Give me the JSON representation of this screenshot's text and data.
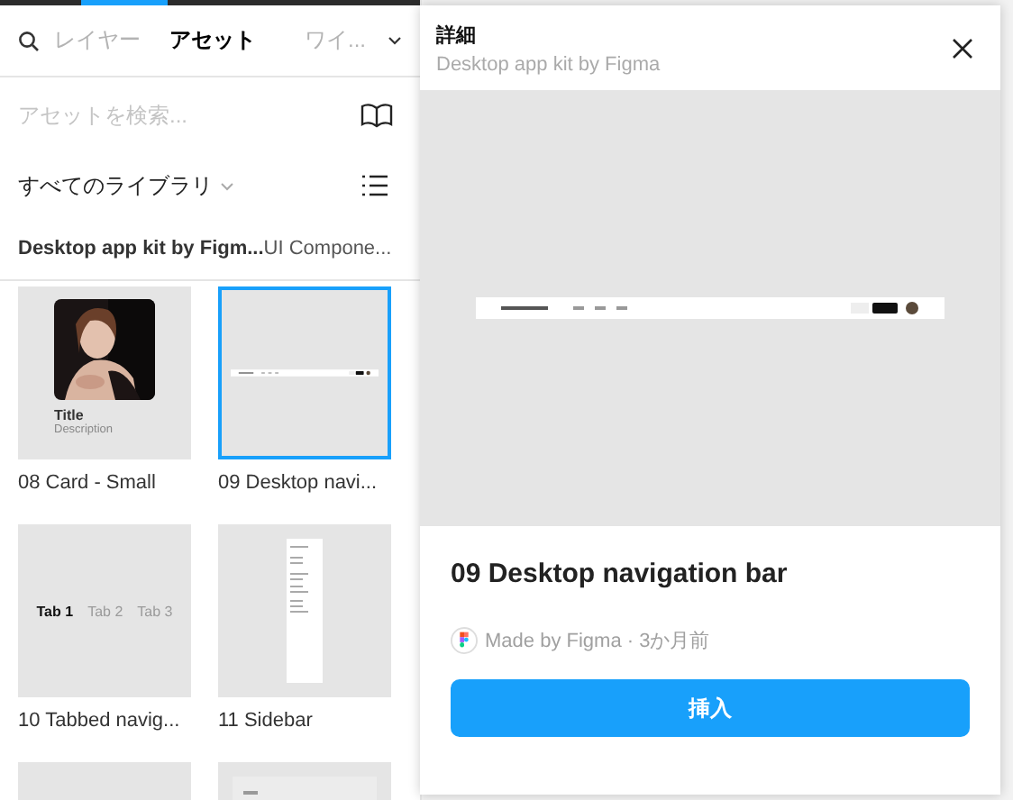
{
  "tabs": [
    {
      "label": "レイヤー",
      "selected": false
    },
    {
      "label": "アセット",
      "selected": true
    },
    {
      "label": "ワイ...",
      "selected": false
    }
  ],
  "search": {
    "placeholder": "アセットを検索..."
  },
  "library_filter": {
    "label": "すべてのライブラリ"
  },
  "breadcrumb": [
    "Desktop app kit by Figm...",
    "UI Compone..."
  ],
  "assets": [
    {
      "kind": "card",
      "name": "08 Card - Small",
      "selected": false,
      "title": "Title",
      "description": "Description"
    },
    {
      "kind": "navbar",
      "name": "09 Desktop navi...",
      "selected": true
    },
    {
      "kind": "tabs",
      "name": "10 Tabbed navig...",
      "selected": false,
      "tabs": [
        {
          "label": "Tab 1",
          "selected": true
        },
        {
          "label": "Tab 2",
          "selected": false
        },
        {
          "label": "Tab 3",
          "selected": false
        }
      ]
    },
    {
      "kind": "sidebar",
      "name": "11 Sidebar",
      "selected": false
    },
    {
      "kind": "blank",
      "selected": false
    },
    {
      "kind": "form",
      "selected": false
    }
  ],
  "detail": {
    "heading": "詳細",
    "subtitle": "Desktop app kit by Figma",
    "name": "09 Desktop navigation bar",
    "meta": "Made by Figma · 3か月前",
    "insert_button": "挿入"
  }
}
